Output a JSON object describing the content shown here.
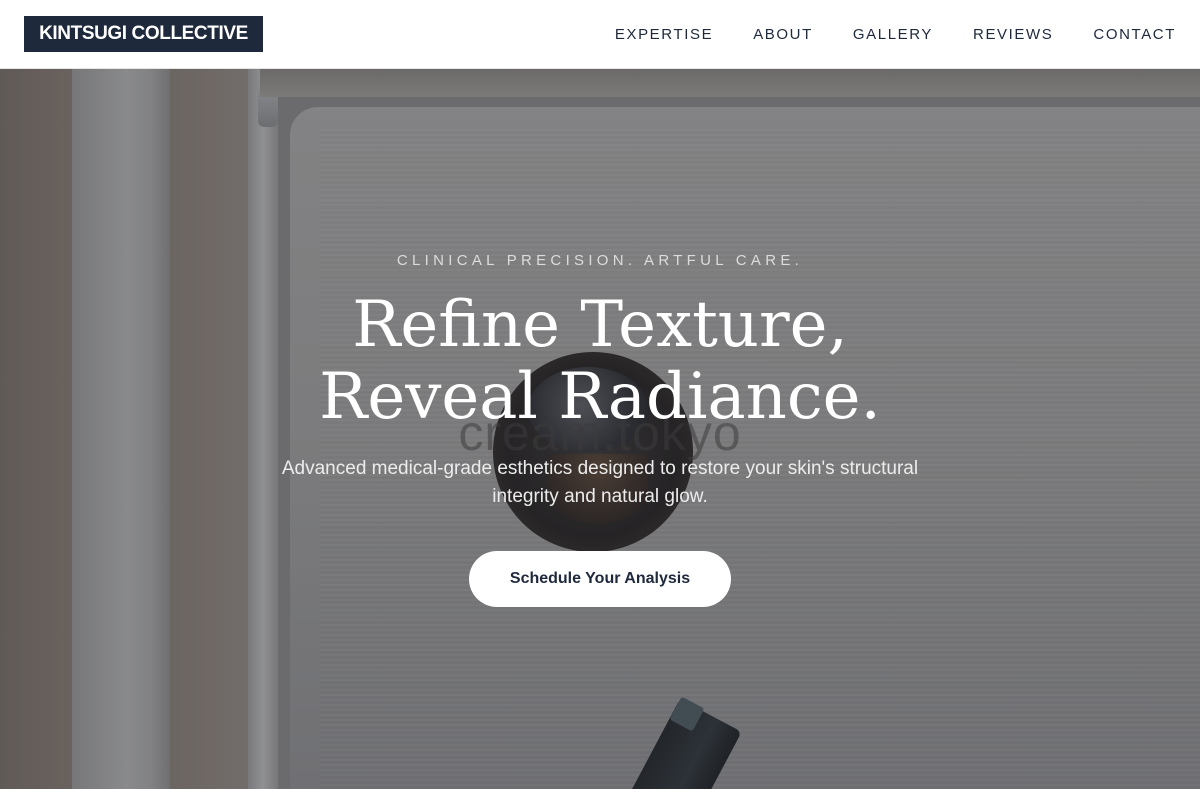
{
  "header": {
    "logo": "KINTSUGI COLLECTIVE",
    "nav": [
      "EXPERTISE",
      "ABOUT",
      "GALLERY",
      "REVIEWS",
      "CONTACT"
    ]
  },
  "hero": {
    "eyebrow": "CLINICAL PRECISION. ARTFUL CARE.",
    "headline_line1": "Refine Texture,",
    "headline_line2": "Reveal Radiance.",
    "subtitle": "Advanced medical-grade esthetics designed to restore your skin's structural integrity and natural glow.",
    "cta_label": "Schedule Your Analysis",
    "background_watermark": "cream.tokyo"
  },
  "colors": {
    "brand_dark": "#1e293b",
    "hero_text": "#ffffff",
    "button_bg": "#ffffff"
  }
}
